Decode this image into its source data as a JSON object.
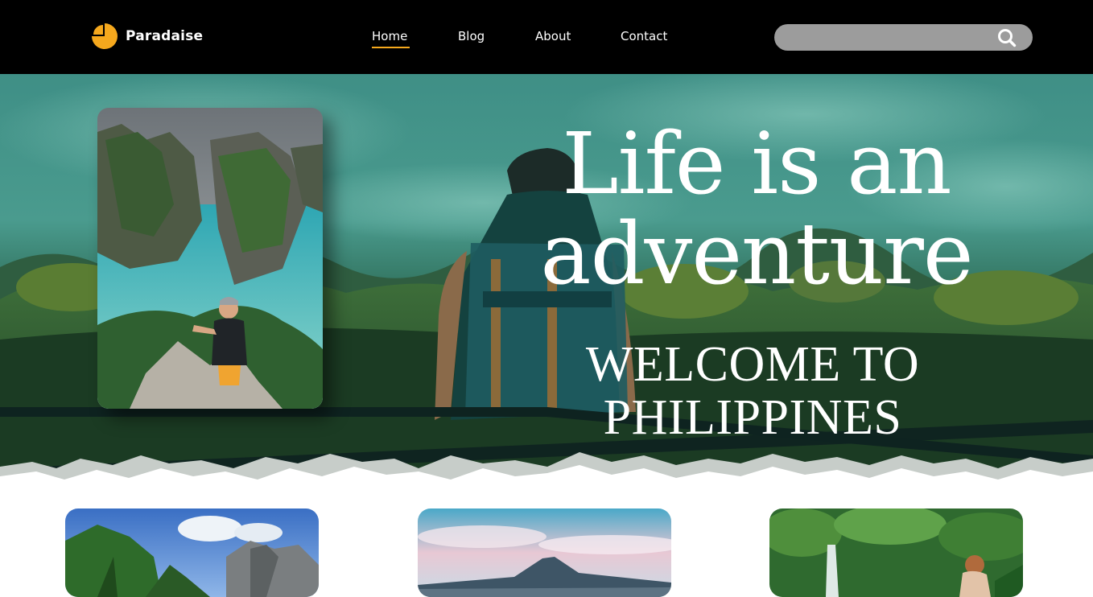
{
  "brand": {
    "name": "Paradaise",
    "accent": "#f5a81d"
  },
  "nav": {
    "items": [
      {
        "label": "Home",
        "active": true
      },
      {
        "label": "Blog",
        "active": false
      },
      {
        "label": "About",
        "active": false
      },
      {
        "label": "Contact",
        "active": false
      }
    ]
  },
  "search": {
    "placeholder": "",
    "icon": "search-icon"
  },
  "hero": {
    "title_line1": "Life is an",
    "title_line2": "adventure",
    "subtitle": "WELCOME TO PHILIPPINES"
  },
  "cards": [
    {
      "name": "card-limestone-cliffs"
    },
    {
      "name": "card-volcano"
    },
    {
      "name": "card-waterfall"
    }
  ]
}
